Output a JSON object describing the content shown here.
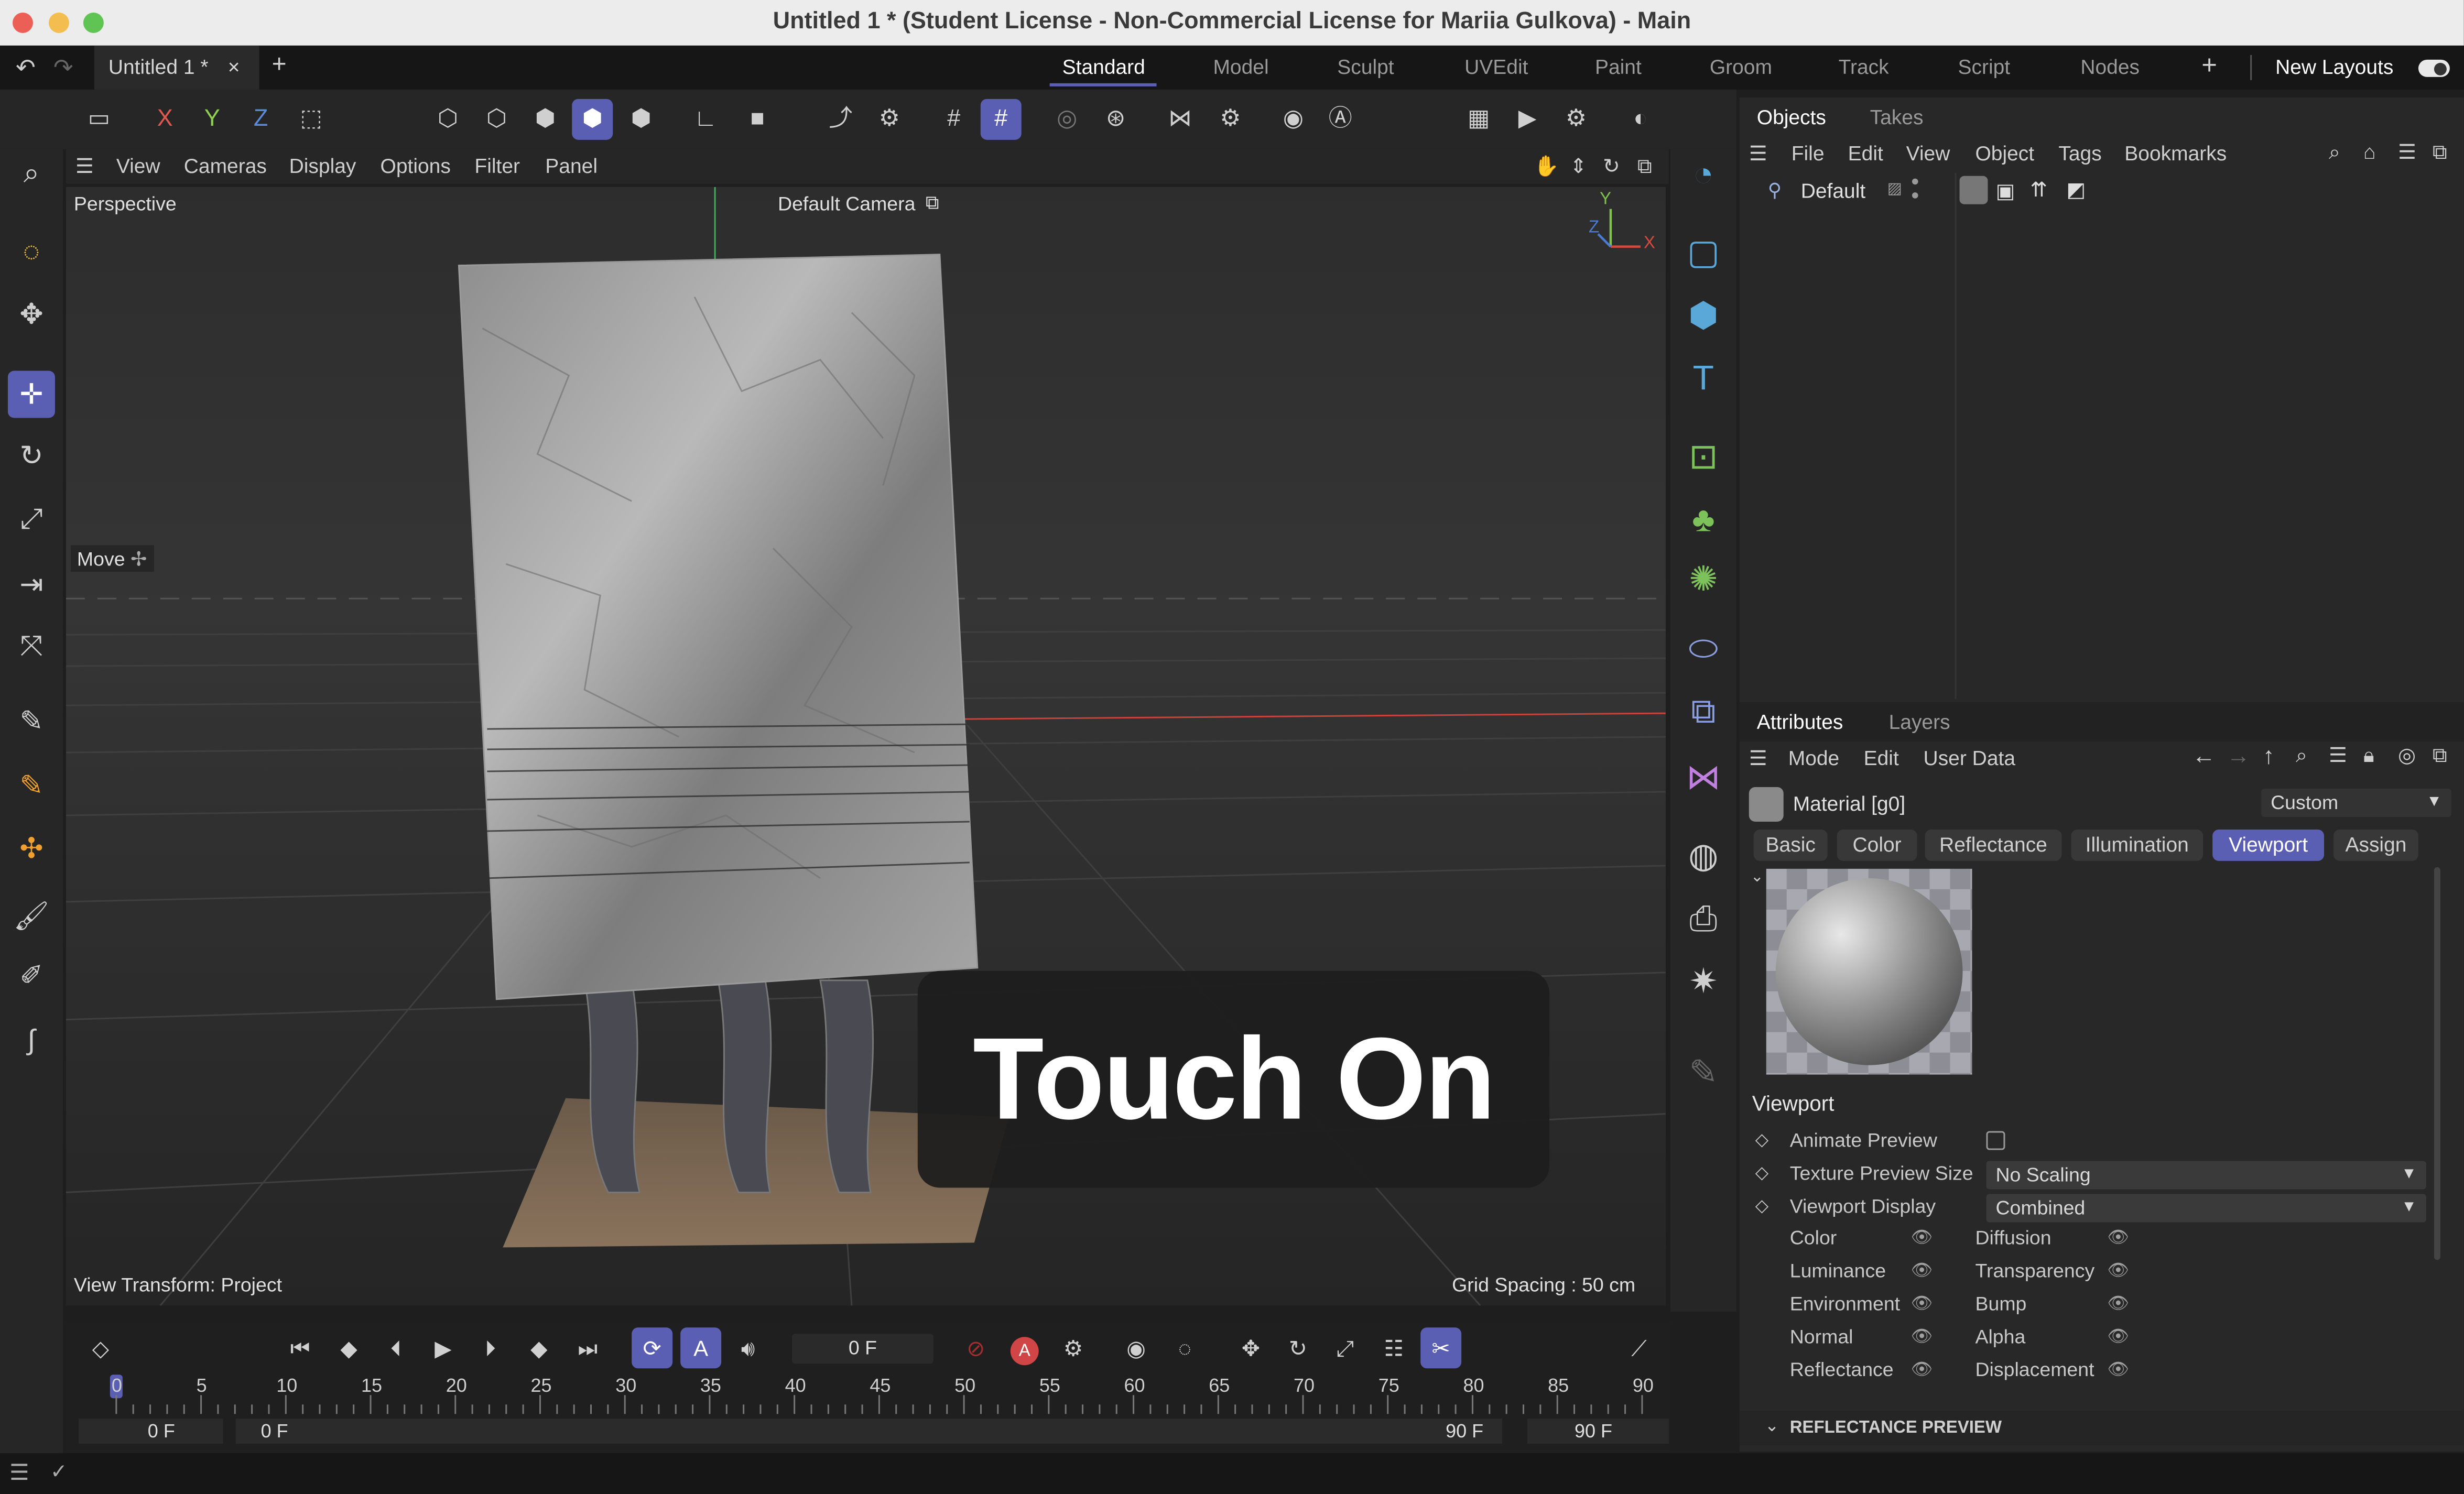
{
  "window": {
    "title": "Untitled 1 * (Student License - Non-Commercial License for Mariia Gulkova) - Main"
  },
  "document_tab": {
    "label": "Untitled 1 *"
  },
  "layouts": {
    "tabs": [
      "Standard",
      "Model",
      "Sculpt",
      "UVEdit",
      "Paint",
      "Groom",
      "Track",
      "Script",
      "Nodes"
    ],
    "active": "Standard",
    "new_layouts_label": "New Layouts"
  },
  "toolbar": {
    "axis_x": "X",
    "axis_y": "Y",
    "axis_z": "Z"
  },
  "viewport": {
    "menu": [
      "View",
      "Cameras",
      "Display",
      "Options",
      "Filter",
      "Panel"
    ],
    "projection_label": "Perspective",
    "camera_label": "Default Camera",
    "tool_label": "Move",
    "view_transform": "View Transform: Project",
    "grid_spacing": "Grid Spacing : 50 cm",
    "axis_y": "Y",
    "axis_z": "Z",
    "axis_x": "X"
  },
  "overlay": {
    "text": "Touch On"
  },
  "objects_panel": {
    "tabs": [
      "Objects",
      "Takes"
    ],
    "menu": [
      "File",
      "Edit",
      "View",
      "Object",
      "Tags",
      "Bookmarks"
    ],
    "object_name": "Default"
  },
  "attributes_panel": {
    "tabs": [
      "Attributes",
      "Layers"
    ],
    "menu": [
      "Mode",
      "Edit",
      "User Data"
    ],
    "material_name": "Material [g0]",
    "preset": "Custom",
    "channel_tabs": [
      "Basic",
      "Color",
      "Reflectance",
      "Illumination",
      "Viewport",
      "Assign"
    ],
    "active_channel_tab": "Viewport",
    "section_title": "Viewport",
    "animate_preview_label": "Animate Preview",
    "texture_preview_size_label": "Texture Preview Size",
    "texture_preview_size_value": "No Scaling",
    "viewport_display_label": "Viewport Display",
    "viewport_display_value": "Combined",
    "channels_left": [
      "Color",
      "Luminance",
      "Environment",
      "Normal",
      "Reflectance"
    ],
    "channels_right": [
      "Diffusion",
      "Transparency",
      "Bump",
      "Alpha",
      "Displacement"
    ],
    "collapsed_section": "REFLECTANCE PREVIEW"
  },
  "timeline": {
    "current_frame": "0 F",
    "ticks": [
      "0",
      "5",
      "10",
      "15",
      "20",
      "25",
      "30",
      "35",
      "40",
      "45",
      "50",
      "55",
      "60",
      "65",
      "70",
      "75",
      "80",
      "85",
      "90"
    ],
    "range_start": "0 F",
    "range_inner_start": "0 F",
    "range_inner_end": "90 F",
    "range_end": "90 F",
    "playhead_frame": 0
  },
  "colors": {
    "accent": "#5b5fb3",
    "x_axis": "#e0584f",
    "y_axis": "#8fd14f",
    "z_axis": "#5b8bd8",
    "green_icon": "#7cc15a",
    "blue_icon": "#5aa8d8"
  }
}
